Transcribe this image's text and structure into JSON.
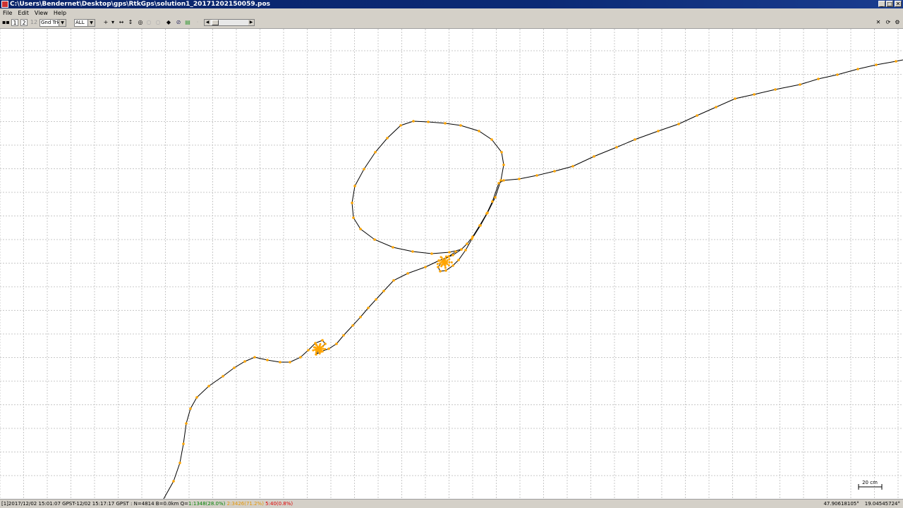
{
  "window": {
    "title": "C:\\Users\\Bendernet\\Desktop\\gps\\RtkGps\\solution1_20171202150059.pos",
    "buttons": {
      "minimize": "_",
      "maximize": "□",
      "close": "✕"
    }
  },
  "menu": {
    "items": [
      "File",
      "Edit",
      "View",
      "Help"
    ]
  },
  "toolbar": {
    "btn1": "1",
    "btn2": "2",
    "btn12": "12",
    "plot_type": "Gnd Trk",
    "quality_filter": "ALL"
  },
  "plot": {
    "scale_label": "20 cm",
    "colors": {
      "track": "#000000",
      "fix": "#ff0000",
      "float": "#ffa500",
      "grid": "#c8c8c8"
    }
  },
  "status": {
    "time_range": "[1]2017/12/02 15:01:07 GPST-12/02 15:17:17 GPST : N=4814 B=0.0km Q=",
    "q1": "1:1348(28.0%)",
    "q2": "2:3426(71.2%)",
    "q5": "5:40(0.8%)",
    "lat": "47.90618105°",
    "lon": "19.04545724°",
    "colors": {
      "q1": "#008000",
      "q2": "#e59400",
      "q5": "#e00000"
    }
  }
}
